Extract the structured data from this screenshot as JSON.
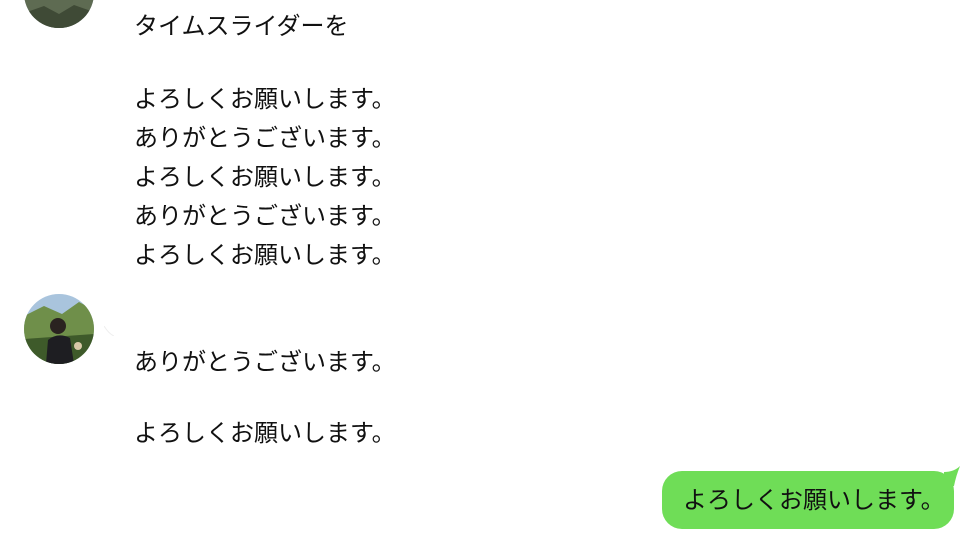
{
  "received_group_1": {
    "lines": [
      "タイムスライダーを",
      "よろしくお願いします。",
      "ありがとうございます。",
      "よろしくお願いします。",
      "ありがとうございます。",
      "よろしくお願いします。"
    ]
  },
  "received_group_2": {
    "sender_name": "",
    "lines": [
      "ありがとうございます。",
      "よろしくお願いします。"
    ]
  },
  "sent_message": {
    "text": "よろしくお願いします。"
  },
  "colors": {
    "sent_bubble": "#6fdd57",
    "background": "#ffffff",
    "text": "#111111"
  }
}
